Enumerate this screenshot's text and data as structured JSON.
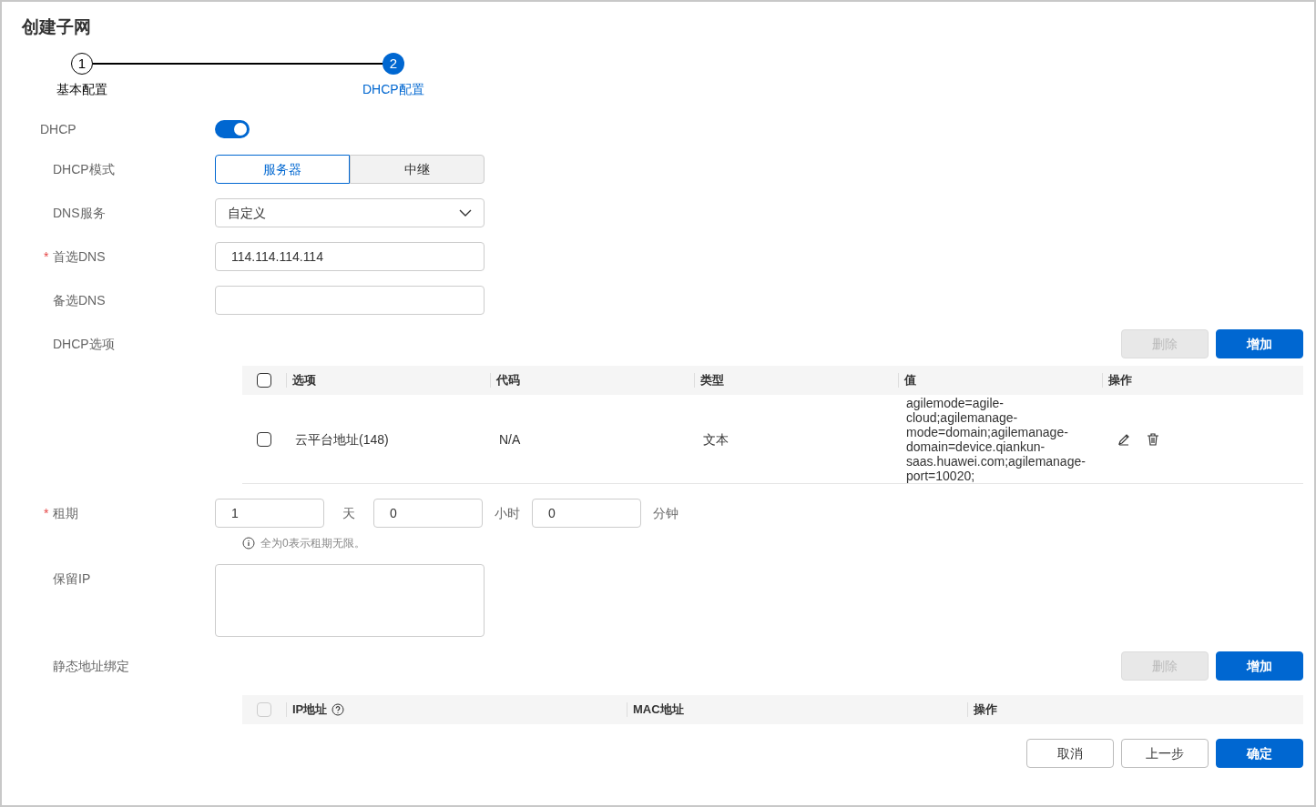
{
  "title": "创建子网",
  "steps": [
    {
      "number": "1",
      "label": "基本配置",
      "selected": false
    },
    {
      "number": "2",
      "label": "DHCP配置",
      "selected": true
    }
  ],
  "dhcp": {
    "label": "DHCP",
    "on": true
  },
  "mode": {
    "label": "DHCP模式",
    "options": [
      {
        "label": "服务器",
        "selected": true
      },
      {
        "label": "中继",
        "selected": false
      }
    ]
  },
  "dns_service": {
    "label": "DNS服务",
    "value": "自定义"
  },
  "primary_dns": {
    "label": "首选DNS",
    "required_mark": "*",
    "value": "114.114.114.114"
  },
  "secondary_dns": {
    "label": "备选DNS"
  },
  "options": {
    "label": "DHCP选项",
    "buttons": [
      {
        "label": "删除",
        "disabled": true
      },
      {
        "label": "增加",
        "disabled": false
      }
    ],
    "columns": [
      "选项",
      "代码",
      "类型",
      "值",
      "操作"
    ],
    "header_checked": false,
    "rows": [
      {
        "checked": false,
        "option": "云平台地址(148)",
        "code": "N/A",
        "type": "文本",
        "value": "agilemode=agile-cloud;agilemanage-mode=domain;agilemanage-domain=device.qiankun-saas.huawei.com;agilemanage-port=10020;"
      }
    ]
  },
  "lease": {
    "label": "租期",
    "required_mark": "*",
    "fields": [
      {
        "value": "1",
        "unit": "天"
      },
      {
        "value": "0",
        "unit": "小时"
      },
      {
        "value": "0",
        "unit": "分钟"
      }
    ],
    "hint": "全为0表示租期无限。"
  },
  "reserved_ip": {
    "label": "保留IP"
  },
  "static_binding": {
    "label": "静态地址绑定",
    "buttons": [
      {
        "label": "删除",
        "disabled": true
      },
      {
        "label": "增加",
        "disabled": false
      }
    ],
    "columns": [
      "IP地址",
      "MAC地址",
      "操作"
    ],
    "header_disabled": true
  },
  "footer": [
    {
      "label": "取消",
      "primary": false
    },
    {
      "label": "上一步",
      "primary": false
    },
    {
      "label": "确定",
      "primary": true
    }
  ]
}
